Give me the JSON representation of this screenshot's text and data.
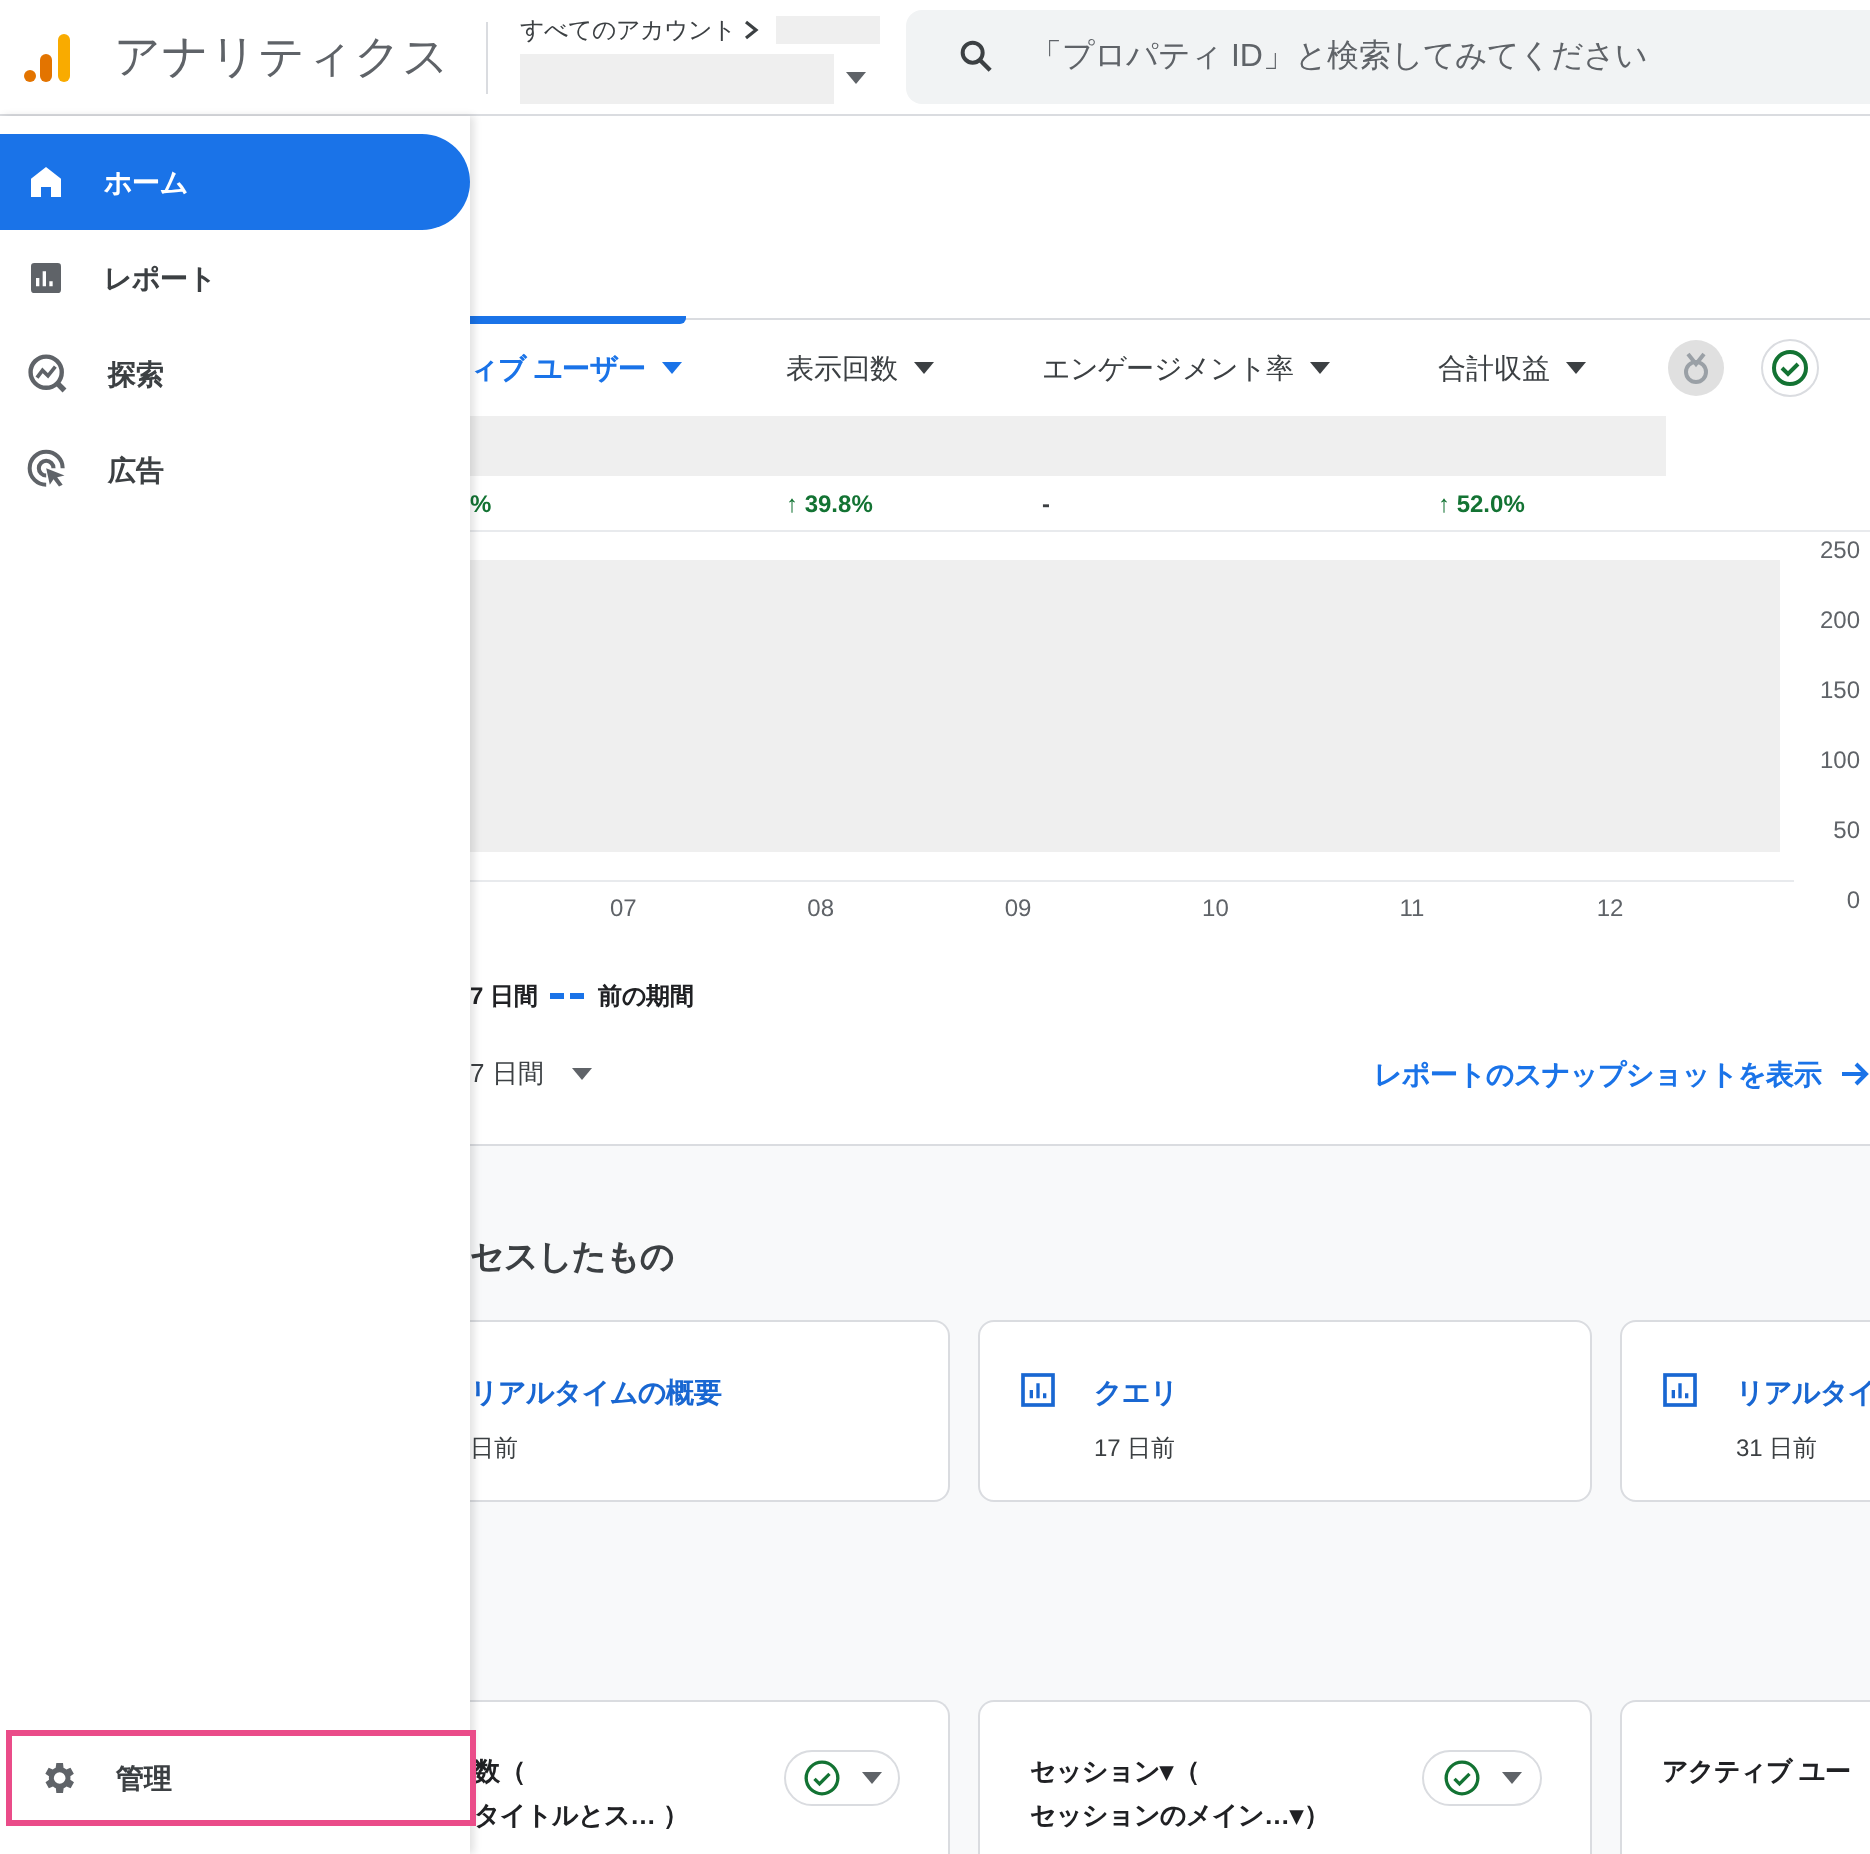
{
  "header": {
    "app_title": "アナリティクス",
    "account_label": "すべてのアカウント",
    "search": {
      "placeholder": "「プロパティ ID」と検索してみてください"
    }
  },
  "sidebar": {
    "items": [
      {
        "label": "ホーム",
        "selected": true
      },
      {
        "label": "レポート",
        "selected": false
      },
      {
        "label": "探索",
        "selected": false
      },
      {
        "label": "広告",
        "selected": false
      }
    ],
    "footer_item": {
      "label": "管理",
      "selected": false,
      "highlighted": true
    }
  },
  "metrics": [
    {
      "label": "ィブ ユーザー",
      "selected": true,
      "change": "%",
      "kind": "positive"
    },
    {
      "label": "表示回数",
      "selected": false,
      "change": "↑ 39.8%",
      "kind": "positive"
    },
    {
      "label": "エンゲージメント率",
      "selected": false,
      "change": "-",
      "kind": "neutral"
    },
    {
      "label": "合計収益",
      "selected": false,
      "change": "↑ 52.0%",
      "kind": "positive"
    }
  ],
  "chart": {
    "y_labels": [
      "250",
      "200",
      "150",
      "100",
      "50",
      "0"
    ],
    "x_labels": [
      "07",
      "08",
      "09",
      "10",
      "11",
      "12"
    ]
  },
  "legend": [
    {
      "label": "7 日間",
      "kind": "plain"
    },
    {
      "label": "前の期間",
      "kind": "dashed"
    }
  ],
  "date_range": "7 日間",
  "snapshot_link": "レポートのスナップショットを表示",
  "recent_section": {
    "title": "セスしたもの",
    "cards": [
      {
        "title": "リアルタイムの概要",
        "time": "日前",
        "icon": false
      },
      {
        "title": "クエリ",
        "time": "17 日前",
        "icon": true
      },
      {
        "title": "リアルタイ",
        "time": "31 日前",
        "icon": true
      }
    ]
  },
  "bottom_cards": [
    {
      "line_1": "数（",
      "line_2": "タイトルとス… ）",
      "check": true
    },
    {
      "line_1": "セッション▾（",
      "line_2": "セッションのメイン…▾）",
      "check": true
    },
    {
      "line_1": "アクティブ ユー",
      "check": false
    }
  ]
}
